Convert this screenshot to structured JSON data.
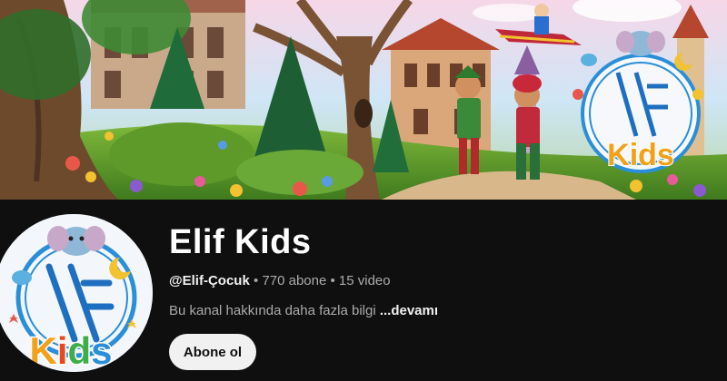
{
  "channel": {
    "name": "Elif Kids",
    "handle": "@Elif-Çocuk",
    "separator": " • ",
    "subscribers": "770 abone",
    "videos": "15 video",
    "about_text": "Bu kanal hakkında daha fazla bilgi ",
    "about_more": "...devamı",
    "subscribe_label": "Abone ol"
  },
  "logo": {
    "letters": "Kids",
    "colors": [
      "#f2a11a",
      "#e8491f",
      "#3fae4a",
      "#2a8fd8"
    ]
  },
  "theme": {
    "background": "#0f0f0f",
    "button_bg": "#f1f1f1",
    "secondary_text": "#aaaaaa"
  }
}
